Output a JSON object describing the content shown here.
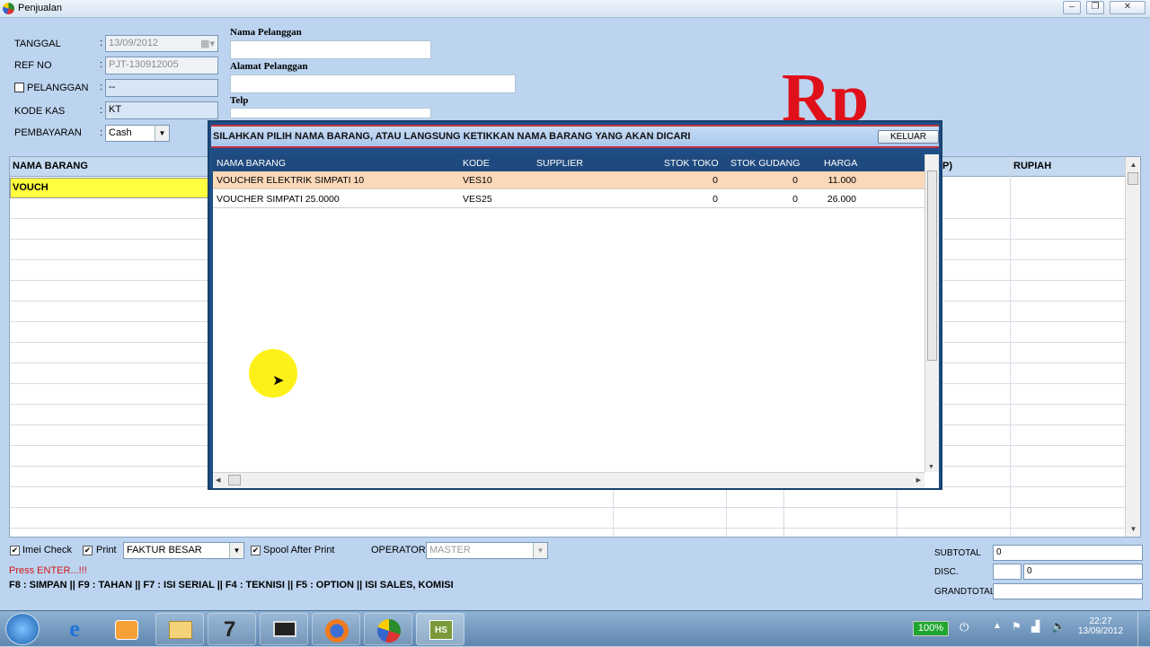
{
  "window": {
    "title": "Penjualan"
  },
  "form": {
    "tanggal_label": "TANGGAL",
    "tanggal_value": "13/09/2012",
    "refno_label": "REF NO",
    "refno_value": "PJT-130912005",
    "pelanggan_label": "PELANGGAN",
    "pelanggan_value": "--",
    "kodekas_label": "KODE KAS",
    "kodekas_value": "KT",
    "pembayaran_label": "PEMBAYARAN",
    "pembayaran_value": "Cash",
    "colon": ":"
  },
  "customer": {
    "nama_label": "Nama Pelanggan",
    "alamat_label": "Alamat Pelanggan",
    "telp_label": "Telp"
  },
  "currency_sign": "Rp",
  "grid": {
    "col_nama": "NAMA BARANG",
    "col_p": "P)",
    "col_rupiah": "RUPIAH",
    "first_cell": "VOUCH"
  },
  "dialog": {
    "title": "SILAHKAN PILIH NAMA BARANG, ATAU LANGSUNG KETIKKAN NAMA BARANG YANG AKAN DICARI",
    "close_label": "KELUAR",
    "columns": [
      "NAMA BARANG",
      "KODE",
      "SUPPLIER",
      "STOK TOKO",
      "STOK GUDANG",
      "HARGA"
    ],
    "rows": [
      {
        "nama": "VOUCHER ELEKTRIK SIMPATI 10",
        "kode": "VES10",
        "supplier": "",
        "stok_toko": "0",
        "stok_gudang": "0",
        "harga": "11.000"
      },
      {
        "nama": "VOUCHER SIMPATI 25.0000",
        "kode": "VES25",
        "supplier": "",
        "stok_toko": "0",
        "stok_gudang": "0",
        "harga": "26.000"
      }
    ]
  },
  "bottom": {
    "imei_label": "Imei Check",
    "print_label": "Print",
    "print_format": "FAKTUR BESAR",
    "spool_label": "Spool After Print",
    "operator_label": "OPERATOR",
    "operator_value": "MASTER",
    "press_enter": "Press ENTER...!!!",
    "shortcuts": "F8 : SIMPAN || F9 : TAHAN || F7 : ISI SERIAL || F4 : TEKNISI || F5 : OPTION || ISI SALES, KOMISI",
    "subtotal_label": "SUBTOTAL",
    "subtotal_value": "0",
    "disc_label": "DISC.",
    "disc_pct": "",
    "disc_value": "0",
    "grandtotal_label": "GRANDTOTAL",
    "grandtotal_value": ""
  },
  "taskbar": {
    "battery": "100%",
    "time": "22:27",
    "date": "13/09/2012"
  },
  "colors": {
    "currency_red": "#e0101a",
    "selected_row": "#fbd8b8",
    "grid_highlight": "#ffff3f",
    "dialog_header": "#1f4a7f"
  }
}
